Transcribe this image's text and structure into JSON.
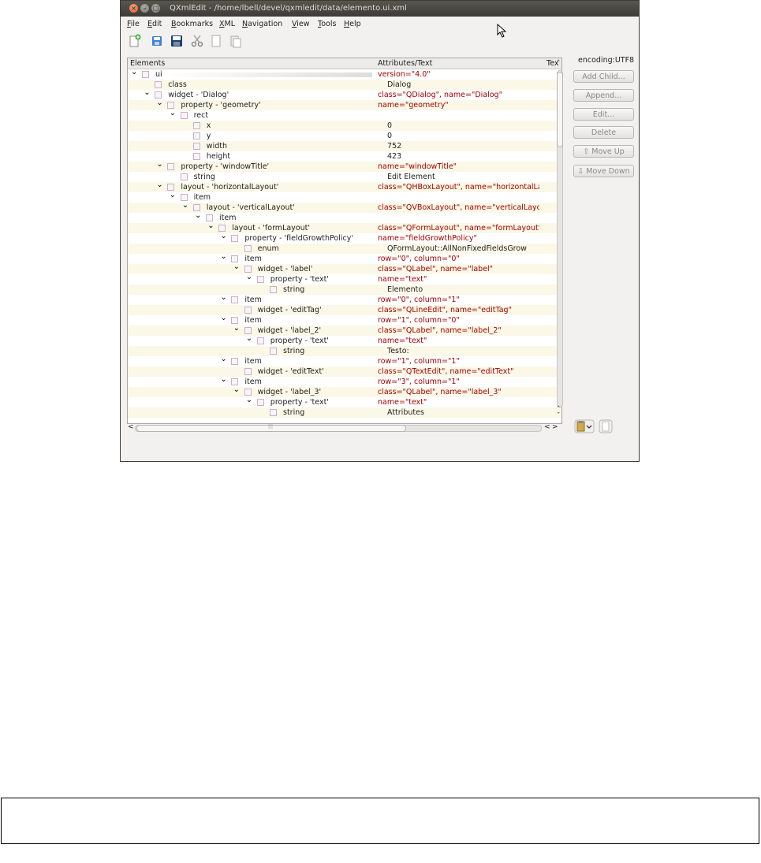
{
  "window": {
    "title": "QXmlEdit - /home/lbell/devel/qxmledit/data/elemento.ui.xml",
    "close_glyph": "×",
    "min_glyph": "–",
    "max_glyph": "□"
  },
  "menu": [
    {
      "label": "File",
      "u": "F",
      "rest": "ile"
    },
    {
      "label": "Edit",
      "u": "E",
      "rest": "dit"
    },
    {
      "label": "Bookmarks",
      "u": "B",
      "rest": "ookmarks"
    },
    {
      "label": "XML",
      "u": "X",
      "rest": "ML"
    },
    {
      "label": "Navigation",
      "u": "N",
      "rest": "avigation"
    },
    {
      "label": "View",
      "u": "V",
      "rest": "iew"
    },
    {
      "label": "Tools",
      "u": "T",
      "rest": "ools"
    },
    {
      "label": "Help",
      "u": "H",
      "rest": "elp"
    }
  ],
  "toolbar": [
    "new-icon",
    "open-icon",
    "save-icon",
    "cut-icon",
    "copy-icon",
    "paste-icon"
  ],
  "tree": {
    "headers": {
      "elements": "Elements",
      "attributes": "Attributes/Text",
      "text": "Tex"
    },
    "rows": [
      {
        "depth": 0,
        "exp": true,
        "label": "ui",
        "attr": "version=\"4.0\"",
        "text": ""
      },
      {
        "depth": 1,
        "exp": false,
        "label": "class",
        "attr": "",
        "text": "Dialog"
      },
      {
        "depth": 1,
        "exp": true,
        "label": "widget - 'Dialog'",
        "attr": "class=\"QDialog\", name=\"Dialog\"",
        "text": ""
      },
      {
        "depth": 2,
        "exp": true,
        "label": "property - 'geometry'",
        "attr": "name=\"geometry\"",
        "text": ""
      },
      {
        "depth": 3,
        "exp": true,
        "label": "rect",
        "attr": "",
        "text": ""
      },
      {
        "depth": 4,
        "exp": false,
        "label": "x",
        "attr": "",
        "text": "0"
      },
      {
        "depth": 4,
        "exp": false,
        "label": "y",
        "attr": "",
        "text": "0"
      },
      {
        "depth": 4,
        "exp": false,
        "label": "width",
        "attr": "",
        "text": "752"
      },
      {
        "depth": 4,
        "exp": false,
        "label": "height",
        "attr": "",
        "text": "423"
      },
      {
        "depth": 2,
        "exp": true,
        "label": "property - 'windowTitle'",
        "attr": "name=\"windowTitle\"",
        "text": ""
      },
      {
        "depth": 3,
        "exp": false,
        "label": "string",
        "attr": "",
        "text": "Edit Element"
      },
      {
        "depth": 2,
        "exp": true,
        "label": "layout - 'horizontalLayout'",
        "attr": "class=\"QHBoxLayout\", name=\"horizontalLay...",
        "text": ""
      },
      {
        "depth": 3,
        "exp": true,
        "label": "item",
        "attr": "",
        "text": ""
      },
      {
        "depth": 4,
        "exp": true,
        "label": "layout - 'verticalLayout'",
        "attr": "class=\"QVBoxLayout\", name=\"verticalLayout\"",
        "text": ""
      },
      {
        "depth": 5,
        "exp": true,
        "label": "item",
        "attr": "",
        "text": ""
      },
      {
        "depth": 6,
        "exp": true,
        "label": "layout - 'formLayout'",
        "attr": "class=\"QFormLayout\", name=\"formLayout\"",
        "text": ""
      },
      {
        "depth": 7,
        "exp": true,
        "label": "property - 'fieldGrowthPolicy'",
        "attr": "name=\"fieldGrowthPolicy\"",
        "text": ""
      },
      {
        "depth": 8,
        "exp": false,
        "label": "enum",
        "attr": "",
        "text": "QFormLayout::AllNonFixedFieldsGrow"
      },
      {
        "depth": 7,
        "exp": true,
        "label": "item",
        "attr": "row=\"0\", column=\"0\"",
        "text": ""
      },
      {
        "depth": 8,
        "exp": true,
        "label": "widget - 'label'",
        "attr": "class=\"QLabel\", name=\"label\"",
        "text": ""
      },
      {
        "depth": 9,
        "exp": true,
        "label": "property - 'text'",
        "attr": "name=\"text\"",
        "text": ""
      },
      {
        "depth": 10,
        "exp": false,
        "label": "string",
        "attr": "",
        "text": "Elemento"
      },
      {
        "depth": 7,
        "exp": true,
        "label": "item",
        "attr": "row=\"0\", column=\"1\"",
        "text": ""
      },
      {
        "depth": 8,
        "exp": false,
        "label": "widget - 'editTag'",
        "attr": "class=\"QLineEdit\", name=\"editTag\"",
        "text": ""
      },
      {
        "depth": 7,
        "exp": true,
        "label": "item",
        "attr": "row=\"1\", column=\"0\"",
        "text": ""
      },
      {
        "depth": 8,
        "exp": true,
        "label": "widget - 'label_2'",
        "attr": "class=\"QLabel\", name=\"label_2\"",
        "text": ""
      },
      {
        "depth": 9,
        "exp": true,
        "label": "property - 'text'",
        "attr": "name=\"text\"",
        "text": ""
      },
      {
        "depth": 10,
        "exp": false,
        "label": "string",
        "attr": "",
        "text": "Testo:"
      },
      {
        "depth": 7,
        "exp": true,
        "label": "item",
        "attr": "row=\"1\", column=\"1\"",
        "text": ""
      },
      {
        "depth": 8,
        "exp": false,
        "label": "widget - 'editText'",
        "attr": "class=\"QTextEdit\", name=\"editText\"",
        "text": ""
      },
      {
        "depth": 7,
        "exp": true,
        "label": "item",
        "attr": "row=\"3\", column=\"1\"",
        "text": ""
      },
      {
        "depth": 8,
        "exp": true,
        "label": "widget - 'label_3'",
        "attr": "class=\"QLabel\", name=\"label_3\"",
        "text": ""
      },
      {
        "depth": 9,
        "exp": true,
        "label": "property - 'text'",
        "attr": "name=\"text\"",
        "text": ""
      },
      {
        "depth": 10,
        "exp": false,
        "label": "string",
        "attr": "",
        "text": "Attributes"
      }
    ]
  },
  "side": {
    "encoding": "encoding:UTF8",
    "buttons": [
      {
        "name": "add-child-button",
        "label": "Add Child...",
        "enabled": false
      },
      {
        "name": "append-button",
        "label": "Append...",
        "enabled": false
      },
      {
        "name": "edit-button",
        "label": "Edit...",
        "enabled": false
      },
      {
        "name": "delete-button",
        "label": "Delete",
        "enabled": false
      },
      {
        "name": "move-up-button",
        "label": "Move Up",
        "enabled": false,
        "icon": "⇧"
      },
      {
        "name": "move-down-button",
        "label": "Move Down",
        "enabled": false,
        "icon": "⇩"
      }
    ]
  },
  "scroll": {
    "up": "ˆ",
    "down": "ˇ",
    "left": "<",
    "right": ">",
    "left2": "<",
    "grip": "|||"
  }
}
